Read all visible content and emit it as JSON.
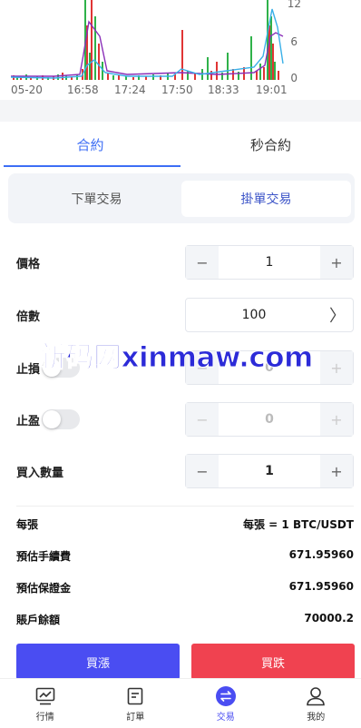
{
  "chart": {
    "x_ticks": [
      "05-20",
      "16:58",
      "17:24",
      "17:50",
      "18:33",
      "19:01"
    ],
    "y_ticks": [
      "12",
      "6",
      "0"
    ]
  },
  "chart_data": {
    "type": "bar",
    "x_tick_labels": [
      "05-20",
      "16:58",
      "17:24",
      "17:50",
      "18:33",
      "19:01"
    ],
    "y_tick_labels": [
      0,
      6,
      12
    ],
    "ylim": [
      0,
      12
    ],
    "bar_colors": [
      "#e03535",
      "#2fb24a"
    ],
    "line_colors": [
      "#8a2fb8",
      "#3ab0e8"
    ]
  },
  "tabs": [
    {
      "label": "合約",
      "active": true
    },
    {
      "label": "秒合約",
      "active": false
    }
  ],
  "order_type": [
    {
      "label": "下單交易",
      "active": false
    },
    {
      "label": "掛單交易",
      "active": true
    }
  ],
  "form": {
    "price_label": "價格",
    "price_value": "1",
    "leverage_label": "倍數",
    "leverage_value": "100",
    "stop_loss_label": "止損",
    "stop_loss_value": "0",
    "take_profit_label": "止盈",
    "take_profit_value": "0",
    "quantity_label": "買入數量",
    "quantity_value": "1",
    "minus": "−",
    "plus": "+",
    "chevron": "〉"
  },
  "info": {
    "per_lot_label": "每張",
    "per_lot_value": "每張 = 1 BTC/USDT",
    "fee_label": "預估手續費",
    "fee_value": "671.95960",
    "margin_label": "預估保證金",
    "margin_value": "671.95960",
    "balance_label": "賬戶餘額",
    "balance_value": "70000.2"
  },
  "actions": {
    "buy_label": "買漲",
    "sell_label": "買跌"
  },
  "watermark": "新码网xinmaw.com",
  "nav": [
    {
      "label": "行情",
      "icon": "chart-icon"
    },
    {
      "label": "訂單",
      "icon": "document-icon"
    },
    {
      "label": "交易",
      "icon": "exchange-icon",
      "active": true
    },
    {
      "label": "我的",
      "icon": "user-icon"
    }
  ],
  "colors": {
    "accent": "#3d6ef5",
    "buy": "#4a4df2",
    "sell": "#f04250"
  }
}
